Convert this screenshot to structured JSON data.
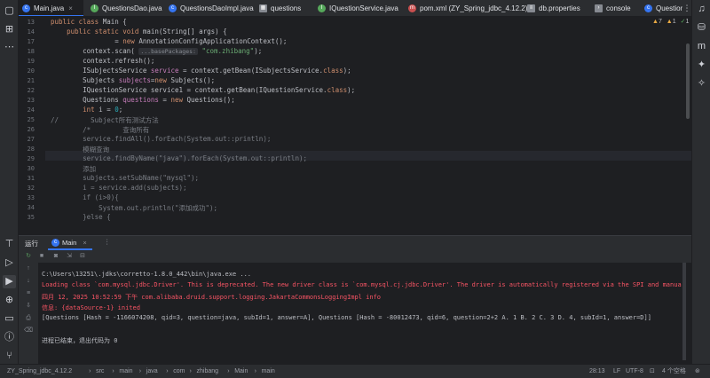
{
  "tabs": [
    {
      "label": "Main.java",
      "icon": "java-class-icon",
      "active": true,
      "color": "#3574f0"
    },
    {
      "label": "QuestionsDao.java",
      "icon": "java-class-icon",
      "active": false,
      "color": "#3574f0"
    },
    {
      "label": "QuestionsDaoImpl.java",
      "icon": "java-class-icon",
      "active": false,
      "color": "#3574f0"
    },
    {
      "label": "questions",
      "icon": "table-icon",
      "active": false,
      "color": "#868a91"
    },
    {
      "label": "IQuestionService.java",
      "icon": "interface-icon",
      "active": false,
      "color": "#56a85b"
    },
    {
      "label": "pom.xml (ZY_Spring_jdbc_4.12.2)",
      "icon": "maven-icon",
      "active": false,
      "color": "#c94f4f"
    },
    {
      "label": "db.properties",
      "icon": "properties-icon",
      "active": false,
      "color": "#868a91"
    },
    {
      "label": "console",
      "icon": "console-icon",
      "active": false,
      "color": "#868a91"
    },
    {
      "label": "Question",
      "icon": "java-class-icon",
      "active": false,
      "color": "#3574f0"
    }
  ],
  "inspections": {
    "warnings": "7",
    "weak_warnings": "1",
    "typos": "1"
  },
  "editor": {
    "lines": [
      {
        "n": "13",
        "html": "<span class=\"kw\">public class</span> Main {"
      },
      {
        "n": "14",
        "html": "    <span class=\"kw\">public static void</span> main(String[] args) {"
      },
      {
        "n": "17",
        "html": "                = <span class=\"kw\">new</span> AnnotationConfigApplicationContext();"
      },
      {
        "n": "18",
        "html": "        context.scan( <span class=\"hint\">...basePackages:</span> <span class=\"str\">\"com.zhibang\"</span>);"
      },
      {
        "n": "19",
        "html": "        context.refresh();"
      },
      {
        "n": "20",
        "html": "        ISubjectsService <span class=\"fld\">service</span> = context.getBean(ISubjectsService.<span class=\"kw\">class</span>);"
      },
      {
        "n": "21",
        "html": "        Subjects <span class=\"fld\">subjects</span>=<span class=\"kw\">new</span> Subjects();"
      },
      {
        "n": "22",
        "html": "        IQuestionService service1 = context.getBean(IQuestionService.<span class=\"kw\">class</span>);"
      },
      {
        "n": "23",
        "html": "        Questions <span class=\"fld\">questions</span> = <span class=\"kw\">new</span> Questions();"
      },
      {
        "n": "24",
        "html": "        <span class=\"kw\">int</span> i = <span class=\"num\">0</span>;"
      },
      {
        "n": "25",
        "html": "<span class=\"cmt\">//        Subject所有测试方法</span>"
      },
      {
        "n": "26",
        "html": "        <span class=\"cmt\">/*        查询所有</span>"
      },
      {
        "n": "27",
        "html": "<span class=\"cmt\">        service.findAll().forEach(System.out::println);</span>"
      },
      {
        "n": "28",
        "html": "<span class=\"cmt\">        模糊查询</span>"
      },
      {
        "n": "29",
        "html": "<span class=\"cmt\">        service.findByName(\"java\").forEach(System.out::println);</span>"
      },
      {
        "n": "30",
        "html": "<span class=\"cmt\">        添加</span>"
      },
      {
        "n": "31",
        "html": "<span class=\"cmt\">        subjects.setSubName(\"mysql\");</span>"
      },
      {
        "n": "32",
        "html": "<span class=\"cmt\">        i = service.add(subjects);</span>"
      },
      {
        "n": "33",
        "html": "<span class=\"cmt\">        if (i&gt;0){</span>"
      },
      {
        "n": "34",
        "html": "<span class=\"cmt\">            System.out.println(\"添加成功\");</span>"
      },
      {
        "n": "35",
        "html": "<span class=\"cmt\">        }else {</span>"
      }
    ]
  },
  "run": {
    "panel_title": "运行",
    "tab_label": "Main",
    "console": [
      {
        "cls": "out",
        "text": "C:\\Users\\13251\\.jdks\\corretto-1.8.0_442\\bin\\java.exe ..."
      },
      {
        "cls": "err",
        "text": "Loading class `com.mysql.jdbc.Driver'. This is deprecated. The new driver class is `com.mysql.cj.jdbc.Driver'. The driver is automatically registered via the SPI and manua"
      },
      {
        "cls": "err",
        "text": "四月 12, 2025 10:52:59 下午 com.alibaba.druid.support.logging.JakartaCommonsLoggingImpl info"
      },
      {
        "cls": "err",
        "text": "信息: {dataSource-1} inited"
      },
      {
        "cls": "out",
        "text": "[Questions [Hash = -1166074208, qid=3, question=java, subId=1, answer=A], Questions [Hash = -80012473, qid=6, question=2+2 A. 1 B. 2 C. 3 D. 4, subId=1, answer=D]]"
      },
      {
        "cls": "out",
        "text": ""
      },
      {
        "cls": "out",
        "text": "进程已结束，退出代码为 0"
      }
    ]
  },
  "status": {
    "breadcrumbs": [
      "ZY_Spring_jdbc_4.12.2",
      "src",
      "main",
      "java",
      "com",
      "zhibang",
      "Main",
      "main"
    ],
    "position": "28:13",
    "line_sep": "LF",
    "encoding": "UTF-8",
    "indent": "4 个空格"
  }
}
